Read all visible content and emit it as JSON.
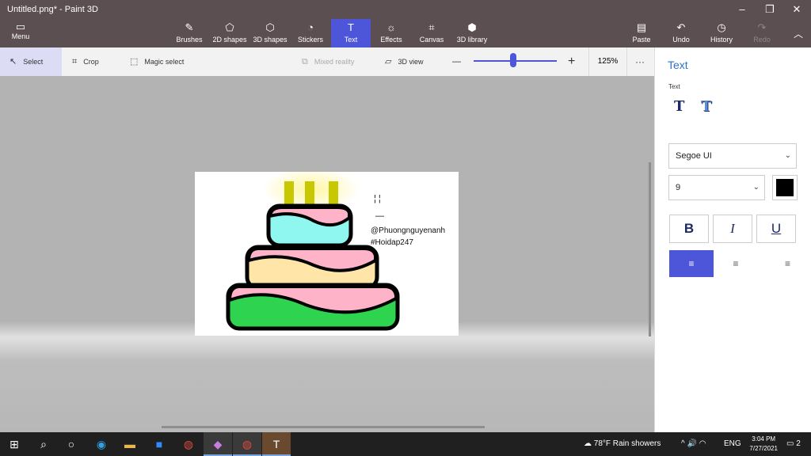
{
  "window": {
    "title": "Untitled.png* - Paint 3D",
    "minimize_glyph": "–",
    "maximize_glyph": "❐",
    "close_glyph": "✕"
  },
  "ribbon": {
    "menu_label": "Menu",
    "tools": [
      {
        "label": "Brushes",
        "icon": "brush-icon",
        "glyph": "✎"
      },
      {
        "label": "2D shapes",
        "icon": "2d-shapes-icon",
        "glyph": "⬠"
      },
      {
        "label": "3D shapes",
        "icon": "3d-shapes-icon",
        "glyph": "⬡"
      },
      {
        "label": "Stickers",
        "icon": "stickers-icon",
        "glyph": "◔"
      },
      {
        "label": "Text",
        "icon": "text-icon",
        "glyph": "T"
      },
      {
        "label": "Effects",
        "icon": "effects-icon",
        "glyph": "☼"
      },
      {
        "label": "Canvas",
        "icon": "canvas-icon",
        "glyph": "⌗"
      },
      {
        "label": "3D library",
        "icon": "3d-library-icon",
        "glyph": "⬢"
      }
    ],
    "active_tool": "Text",
    "right_tools": [
      {
        "label": "Paste",
        "icon": "paste-icon",
        "glyph": "▤"
      },
      {
        "label": "Undo",
        "icon": "undo-icon",
        "glyph": "↶"
      },
      {
        "label": "History",
        "icon": "history-icon",
        "glyph": "◷"
      },
      {
        "label": "Redo",
        "icon": "redo-icon",
        "glyph": "↷"
      }
    ],
    "collapse_glyph": "︿"
  },
  "subtoolbar": {
    "select": "Select",
    "crop": "Crop",
    "magic_select": "Magic select",
    "mixed_reality": "Mixed reality",
    "view_3d": "3D view",
    "zoom_out": "—",
    "zoom_in": "+",
    "zoom_level": "125%",
    "more": "···",
    "zoom_fraction": 0.48
  },
  "canvas_content": {
    "mark_1": "¦ ¦",
    "mark_2": "—",
    "handle": "@Phuongnguyenanh",
    "tag": "#Hoidap247"
  },
  "panel": {
    "title": "Text",
    "subtitle": "Text",
    "font_family": "Segoe UI",
    "font_size": "9",
    "color": "#000000",
    "bold": "B",
    "italic": "I",
    "underline": "U",
    "align_left": "≡",
    "align_center": "≡",
    "align_right": "≡",
    "chevron": "⌄"
  },
  "taskbar": {
    "start": "⊞",
    "search": "⌕",
    "task_view": "○",
    "apps": [
      {
        "name": "edge-icon",
        "glyph": "◉",
        "color": "#2fa3e6"
      },
      {
        "name": "file-explorer-icon",
        "glyph": "▬",
        "color": "#e8b84a"
      },
      {
        "name": "zoom-icon",
        "glyph": "■",
        "color": "#2d8cff"
      },
      {
        "name": "chrome-icon",
        "glyph": "◍",
        "color": "#e04a3c"
      },
      {
        "name": "paint3d-icon",
        "glyph": "◆",
        "color": "#c77ce0"
      },
      {
        "name": "chrome-profile-icon",
        "glyph": "◍",
        "color": "#e04a3c"
      },
      {
        "name": "teams-icon",
        "glyph": "T",
        "color": "#6264a7"
      }
    ],
    "weather": "78°F  Rain showers",
    "tray": "^  🔊  ◠",
    "lang": "ENG",
    "time": "3:04 PM",
    "date": "7/27/2021",
    "notif": "2"
  }
}
